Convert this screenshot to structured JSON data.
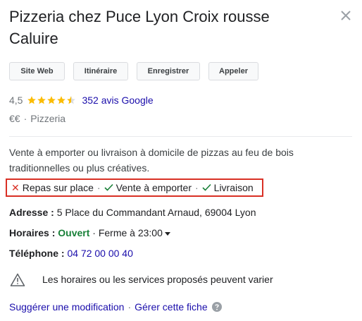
{
  "place": {
    "title": "Pizzeria chez Puce Lyon Croix rousse Caluire"
  },
  "actions": {
    "website": "Site Web",
    "directions": "Itinéraire",
    "save": "Enregistrer",
    "call": "Appeler"
  },
  "rating": {
    "score": "4,5",
    "stars": 4.5,
    "reviews": "352 avis Google"
  },
  "meta": {
    "price": "€€",
    "separator": "·",
    "category": "Pizzeria"
  },
  "description": "Vente à emporter ou livraison à domicile de pizzas au feu de bois traditionnelles ou plus créatives.",
  "services": {
    "items": [
      {
        "label": "Repas sur place",
        "available": false
      },
      {
        "label": "Vente à emporter",
        "available": true
      },
      {
        "label": "Livraison",
        "available": true
      }
    ],
    "separator": "·"
  },
  "address": {
    "label": "Adresse :",
    "value": "5 Place du Commandant Arnaud, 69004 Lyon"
  },
  "hours": {
    "label": "Horaires :",
    "status": "Ouvert",
    "separator": "·",
    "closes": "Ferme à 23:00"
  },
  "phone": {
    "label": "Téléphone :",
    "value": "04 72 00 00 40"
  },
  "notice": "Les horaires ou les services proposés peuvent varier",
  "footer": {
    "suggest": "Suggérer une modification",
    "separator": "·",
    "manage": "Gérer cette fiche"
  },
  "colors": {
    "star": "#fbbc04",
    "link": "#1a0dab",
    "open": "#188038",
    "highlight_border": "#d93025"
  }
}
